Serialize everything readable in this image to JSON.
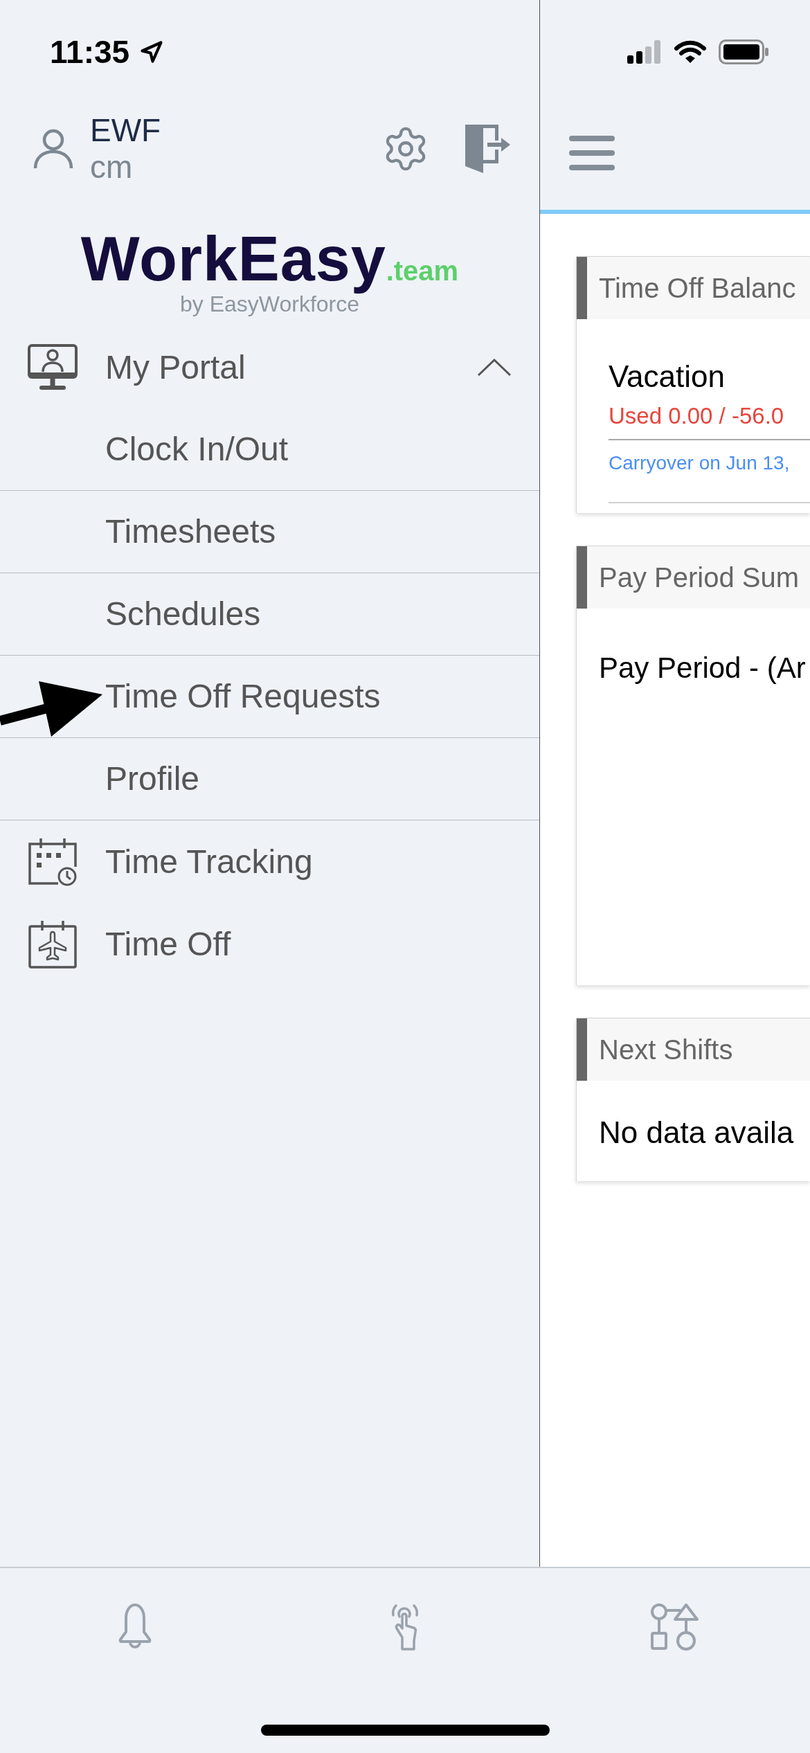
{
  "status_bar": {
    "time": "11:35"
  },
  "drawer": {
    "user": {
      "name": "EWF",
      "account": "cm"
    },
    "logo": {
      "wordmark": "WorkEasy",
      "suffix": ".team",
      "tagline": "by EasyWorkforce"
    },
    "menu": [
      {
        "label": "My Portal",
        "expanded": true,
        "children": [
          {
            "label": "Clock In/Out"
          },
          {
            "label": "Timesheets"
          },
          {
            "label": "Schedules"
          },
          {
            "label": "Time Off Requests"
          },
          {
            "label": "Profile"
          }
        ]
      },
      {
        "label": "Time Tracking"
      },
      {
        "label": "Time Off"
      }
    ]
  },
  "dashboard": {
    "cards": [
      {
        "kind": "balances",
        "title": "Time Off Balanc",
        "balances": [
          {
            "name": "Vacation",
            "usage": "Used 0.00 / -56.0",
            "note": "Carryover on Jun 13,"
          }
        ]
      },
      {
        "kind": "summary",
        "title": "Pay Period Sum",
        "text": "Pay Period - (Ar"
      },
      {
        "kind": "empty",
        "title": "Next Shifts",
        "text": "No data availa"
      }
    ]
  }
}
